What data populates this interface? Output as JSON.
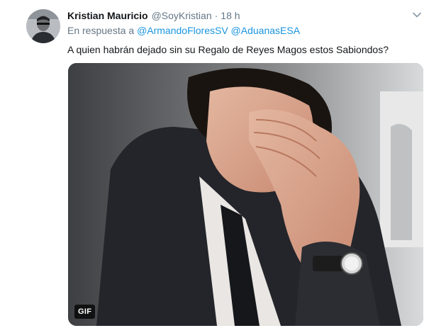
{
  "tweet": {
    "author_name": "Kristian Mauricio",
    "author_handle": "@SoyKristian",
    "separator": "·",
    "time": "18 h",
    "reply_prefix": "En respuesta a",
    "reply_mentions": [
      "@ArmandoFloresSV",
      "@AduanasESA"
    ],
    "text": "A quien habrán dejado sin su Regalo de Reyes Magos estos Sabiondos?",
    "media_badge": "GIF"
  },
  "icons": {
    "avatar": "profile-photo",
    "caret": "chevron-down-icon"
  },
  "colors": {
    "link": "#1b95e0",
    "secondary_text": "#657786",
    "primary_text": "#14171a"
  }
}
